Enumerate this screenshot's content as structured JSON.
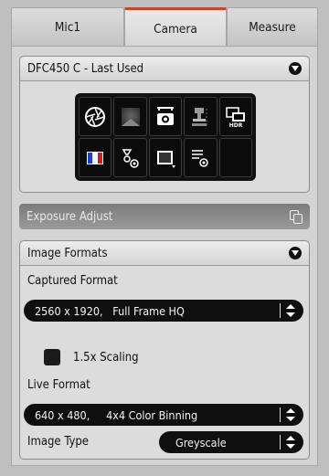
{
  "tabs": [
    {
      "label": "Mic1"
    },
    {
      "label": "Camera",
      "active": true
    },
    {
      "label": "Measure"
    }
  ],
  "camera_section": {
    "title": "DFC450 C - Last Used",
    "tools_row1": [
      "aperture-icon",
      "brightness-gradient-icon",
      "camera-snapshot-icon",
      "microscope-stage-icon",
      "hdr-icon"
    ],
    "tools_row2": [
      "color-channels-icon",
      "settings-gears-icon",
      "image-display-icon",
      "adjust-settings-icon",
      "empty-slot"
    ]
  },
  "exposure": {
    "title": "Exposure Adjust"
  },
  "image_formats": {
    "title": "Image Formats",
    "captured_label": "Captured Format",
    "captured_value": "2560 x 1920,   Full Frame HQ",
    "scaling_label": "1.5x Scaling",
    "scaling_checked": false,
    "live_label": "Live Format",
    "live_value": "640 x 480,     4x4 Color Binning",
    "image_type_label": "Image Type",
    "image_type_value": "Greyscale"
  },
  "colors": {
    "accent_tab": "#c8462e",
    "control_bg": "#0f0f0f"
  }
}
